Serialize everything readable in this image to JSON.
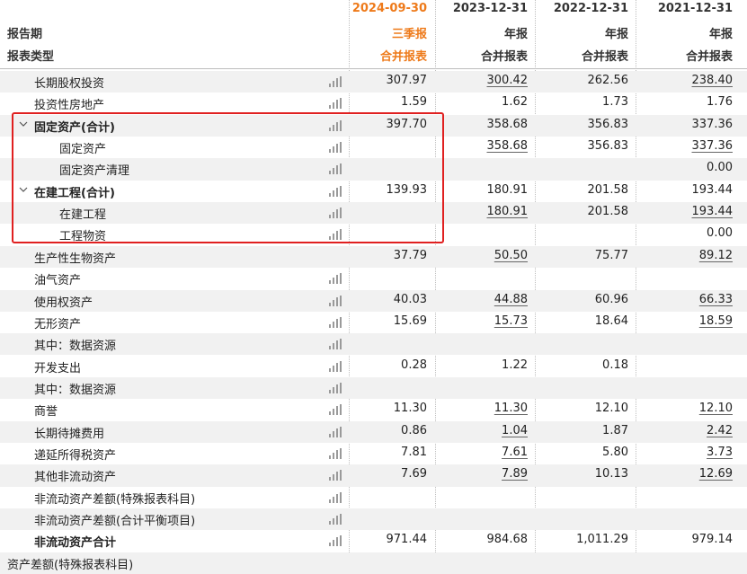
{
  "header": {
    "report_period_label": "报告期",
    "report_type_label": "报表类型",
    "columns": [
      {
        "date": "2024-09-30",
        "period": "三季报",
        "type": "合并报表",
        "highlight": true
      },
      {
        "date": "2023-12-31",
        "period": "年报",
        "type": "合并报表",
        "highlight": false
      },
      {
        "date": "2022-12-31",
        "period": "年报",
        "type": "合并报表",
        "highlight": false
      },
      {
        "date": "2021-12-31",
        "period": "年报",
        "type": "合并报表",
        "highlight": false
      }
    ]
  },
  "rows": [
    {
      "name": "长期股权投资",
      "level": 1,
      "bold": false,
      "expand": false,
      "chart": true,
      "values": [
        "307.97",
        "300.42",
        "262.56",
        "238.40"
      ],
      "underline": [
        false,
        true,
        false,
        true
      ]
    },
    {
      "name": "投资性房地产",
      "level": 1,
      "bold": false,
      "expand": false,
      "chart": true,
      "values": [
        "1.59",
        "1.62",
        "1.73",
        "1.76"
      ],
      "underline": [
        false,
        false,
        false,
        false
      ]
    },
    {
      "name": "固定资产(合计)",
      "level": 1,
      "bold": true,
      "expand": true,
      "chart": true,
      "values": [
        "397.70",
        "358.68",
        "356.83",
        "337.36"
      ],
      "underline": [
        false,
        false,
        false,
        false
      ]
    },
    {
      "name": "固定资产",
      "level": 2,
      "bold": false,
      "expand": false,
      "chart": true,
      "values": [
        "",
        "358.68",
        "356.83",
        "337.36"
      ],
      "underline": [
        false,
        true,
        false,
        true
      ]
    },
    {
      "name": "固定资产清理",
      "level": 2,
      "bold": false,
      "expand": false,
      "chart": true,
      "values": [
        "",
        "",
        "",
        "0.00"
      ],
      "underline": [
        false,
        false,
        false,
        false
      ]
    },
    {
      "name": "在建工程(合计)",
      "level": 1,
      "bold": true,
      "expand": true,
      "chart": true,
      "values": [
        "139.93",
        "180.91",
        "201.58",
        "193.44"
      ],
      "underline": [
        false,
        false,
        false,
        false
      ]
    },
    {
      "name": "在建工程",
      "level": 2,
      "bold": false,
      "expand": false,
      "chart": true,
      "values": [
        "",
        "180.91",
        "201.58",
        "193.44"
      ],
      "underline": [
        false,
        true,
        false,
        true
      ]
    },
    {
      "name": "工程物资",
      "level": 2,
      "bold": false,
      "expand": false,
      "chart": true,
      "values": [
        "",
        "",
        "",
        "0.00"
      ],
      "underline": [
        false,
        false,
        false,
        false
      ]
    },
    {
      "name": "生产性生物资产",
      "level": 1,
      "bold": false,
      "expand": false,
      "chart": false,
      "values": [
        "37.79",
        "50.50",
        "75.77",
        "89.12"
      ],
      "underline": [
        false,
        true,
        false,
        true
      ]
    },
    {
      "name": "油气资产",
      "level": 1,
      "bold": false,
      "expand": false,
      "chart": true,
      "values": [
        "",
        "",
        "",
        ""
      ],
      "underline": [
        false,
        false,
        false,
        false
      ]
    },
    {
      "name": "使用权资产",
      "level": 1,
      "bold": false,
      "expand": false,
      "chart": true,
      "values": [
        "40.03",
        "44.88",
        "60.96",
        "66.33"
      ],
      "underline": [
        false,
        true,
        false,
        true
      ]
    },
    {
      "name": "无形资产",
      "level": 1,
      "bold": false,
      "expand": false,
      "chart": true,
      "values": [
        "15.69",
        "15.73",
        "18.64",
        "18.59"
      ],
      "underline": [
        false,
        true,
        false,
        true
      ]
    },
    {
      "name": "其中：数据资源",
      "level": 1,
      "bold": false,
      "expand": false,
      "chart": true,
      "values": [
        "",
        "",
        "",
        ""
      ],
      "underline": [
        false,
        false,
        false,
        false
      ]
    },
    {
      "name": "开发支出",
      "level": 1,
      "bold": false,
      "expand": false,
      "chart": true,
      "values": [
        "0.28",
        "1.22",
        "0.18",
        ""
      ],
      "underline": [
        false,
        false,
        false,
        false
      ]
    },
    {
      "name": "其中：数据资源",
      "level": 1,
      "bold": false,
      "expand": false,
      "chart": true,
      "values": [
        "",
        "",
        "",
        ""
      ],
      "underline": [
        false,
        false,
        false,
        false
      ]
    },
    {
      "name": "商誉",
      "level": 1,
      "bold": false,
      "expand": false,
      "chart": true,
      "values": [
        "11.30",
        "11.30",
        "12.10",
        "12.10"
      ],
      "underline": [
        false,
        true,
        false,
        true
      ]
    },
    {
      "name": "长期待摊费用",
      "level": 1,
      "bold": false,
      "expand": false,
      "chart": true,
      "values": [
        "0.86",
        "1.04",
        "1.87",
        "2.42"
      ],
      "underline": [
        false,
        true,
        false,
        true
      ]
    },
    {
      "name": "递延所得税资产",
      "level": 1,
      "bold": false,
      "expand": false,
      "chart": true,
      "values": [
        "7.81",
        "7.61",
        "5.80",
        "3.73"
      ],
      "underline": [
        false,
        true,
        false,
        true
      ]
    },
    {
      "name": "其他非流动资产",
      "level": 1,
      "bold": false,
      "expand": false,
      "chart": true,
      "values": [
        "7.69",
        "7.89",
        "10.13",
        "12.69"
      ],
      "underline": [
        false,
        true,
        false,
        true
      ]
    },
    {
      "name": "非流动资产差额(特殊报表科目)",
      "level": 1,
      "bold": false,
      "expand": false,
      "chart": true,
      "values": [
        "",
        "",
        "",
        ""
      ],
      "underline": [
        false,
        false,
        false,
        false
      ]
    },
    {
      "name": "非流动资产差额(合计平衡项目)",
      "level": 1,
      "bold": false,
      "expand": false,
      "chart": true,
      "values": [
        "",
        "",
        "",
        ""
      ],
      "underline": [
        false,
        false,
        false,
        false
      ]
    },
    {
      "name": "非流动资产合计",
      "level": 1,
      "bold": true,
      "expand": false,
      "chart": true,
      "values": [
        "971.44",
        "984.68",
        "1,011.29",
        "979.14"
      ],
      "underline": [
        false,
        false,
        false,
        false
      ]
    },
    {
      "name": "资产差额(特殊报表科目)",
      "level": 0,
      "bold": false,
      "expand": false,
      "chart": false,
      "values": [
        "",
        "",
        "",
        ""
      ],
      "underline": [
        false,
        false,
        false,
        false
      ]
    }
  ]
}
